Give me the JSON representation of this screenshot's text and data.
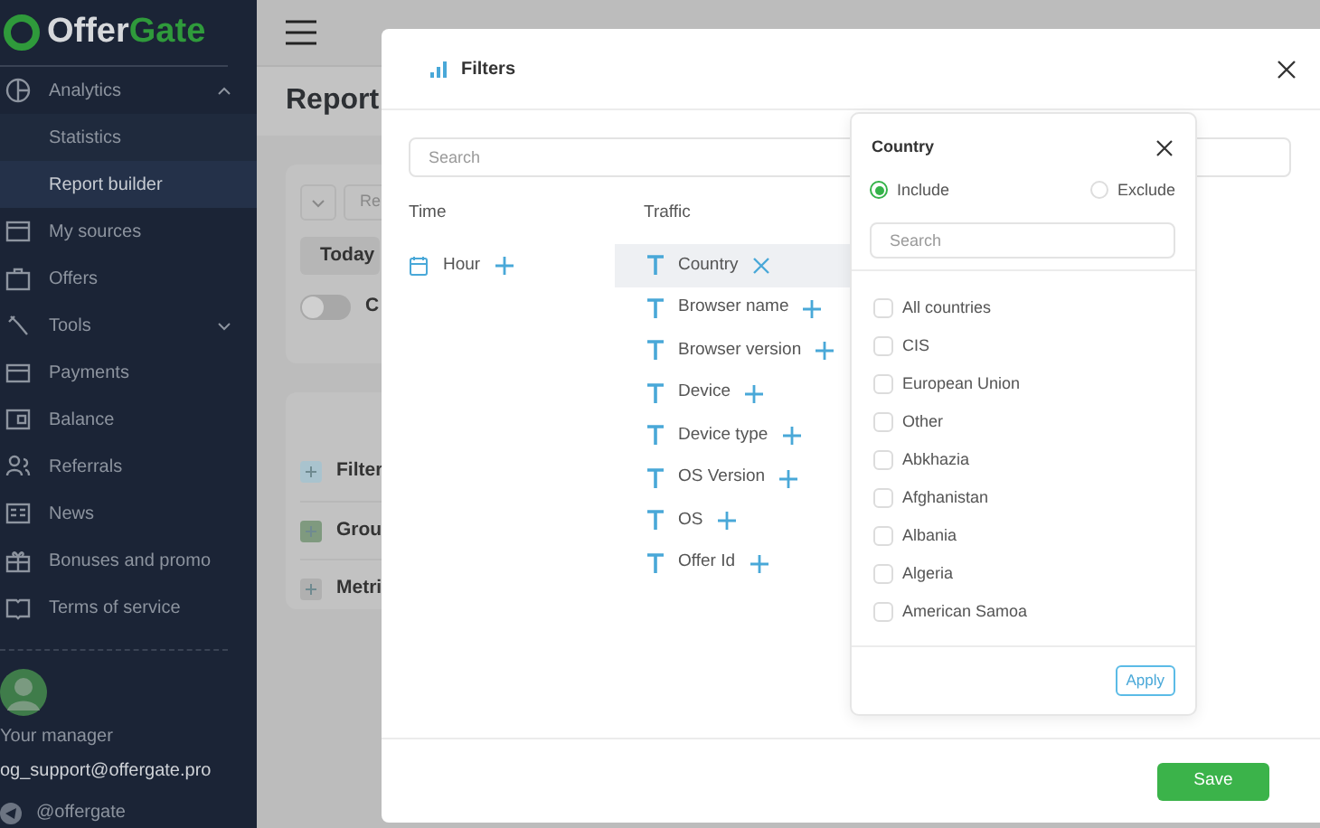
{
  "sidebar": {
    "logo": {
      "part_1": "Offer",
      "part_2": "Gate"
    },
    "items": [
      {
        "label": "Analytics",
        "selected": false,
        "expanded": true,
        "children": [
          {
            "label": "Statistics",
            "selected": false
          },
          {
            "label": "Report builder",
            "selected": true
          }
        ]
      },
      {
        "label": "My sources",
        "selected": false
      },
      {
        "label": "Offers",
        "selected": false
      },
      {
        "label": "Tools",
        "selected": false,
        "expanded": false
      },
      {
        "label": "Payments",
        "selected": false
      },
      {
        "label": "Balance",
        "selected": false
      },
      {
        "label": "Referrals",
        "selected": false
      },
      {
        "label": "News",
        "selected": false
      },
      {
        "label": "Bonuses and promo",
        "selected": false
      },
      {
        "label": "Terms of service",
        "selected": false
      }
    ],
    "manager": {
      "label": "Your manager",
      "email": "og_support@offergate.pro",
      "telegram": "@offergate"
    }
  },
  "page": {
    "title": "Report",
    "date_field": "Re",
    "date_button": "Today",
    "toggle": {
      "label": "C",
      "on": false
    },
    "sections": [
      "Filter",
      "Grou",
      "Metri"
    ]
  },
  "modal": {
    "title": "Filters",
    "search_placeholder": "Search",
    "columns": [
      {
        "heading": "Time",
        "items": [
          {
            "label": "Hour",
            "kind": "date",
            "selected": false
          }
        ]
      },
      {
        "heading": "Traffic",
        "items": [
          {
            "label": "Country",
            "kind": "text",
            "selected": true
          },
          {
            "label": "Browser name",
            "kind": "text",
            "selected": false
          },
          {
            "label": "Browser version",
            "kind": "text",
            "selected": false
          },
          {
            "label": "Device",
            "kind": "text",
            "selected": false
          },
          {
            "label": "Device type",
            "kind": "text",
            "selected": false
          },
          {
            "label": "OS Version",
            "kind": "text",
            "selected": false
          },
          {
            "label": "OS",
            "kind": "text",
            "selected": false
          },
          {
            "label": "Offer Id",
            "kind": "text",
            "selected": false
          }
        ]
      }
    ],
    "save": "Save"
  },
  "popover": {
    "title": "Country",
    "modes": [
      {
        "label": "Include",
        "selected": true
      },
      {
        "label": "Exclude",
        "selected": false
      }
    ],
    "search_placeholder": "Search",
    "options": [
      {
        "label": "All countries",
        "checked": false
      },
      {
        "label": "CIS",
        "checked": false
      },
      {
        "label": "European Union",
        "checked": false
      },
      {
        "label": "Other",
        "checked": false
      },
      {
        "label": "Abkhazia",
        "checked": false
      },
      {
        "label": "Afghanistan",
        "checked": false
      },
      {
        "label": "Albania",
        "checked": false
      },
      {
        "label": "Algeria",
        "checked": false
      },
      {
        "label": "American Samoa",
        "checked": false
      }
    ],
    "apply": "Apply"
  }
}
